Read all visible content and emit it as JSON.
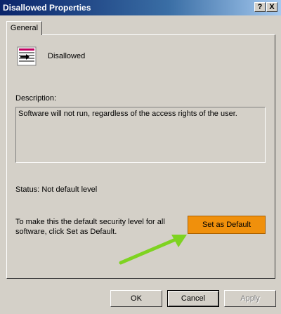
{
  "window": {
    "title": "Disallowed Properties",
    "help_button": "?",
    "close_button": "X"
  },
  "tabs": [
    {
      "label": "General"
    }
  ],
  "general": {
    "item_name": "Disallowed",
    "description_label": "Description:",
    "description_text": "Software will not run, regardless of the access rights of the user.",
    "status_label": "Status:",
    "status_value": "Not default level",
    "info_text": "To make this the default security level for all software, click Set as Default.",
    "set_default_label": "Set as Default"
  },
  "footer": {
    "ok_label": "OK",
    "cancel_label": "Cancel",
    "apply_label": "Apply"
  },
  "icons": {
    "policy": "policy-list-icon",
    "arrow": "arrow-annotation-icon"
  },
  "colors": {
    "titlebar": "#0a246a",
    "highlight_button": "#f0900c",
    "annotation_arrow": "#7ed321"
  }
}
